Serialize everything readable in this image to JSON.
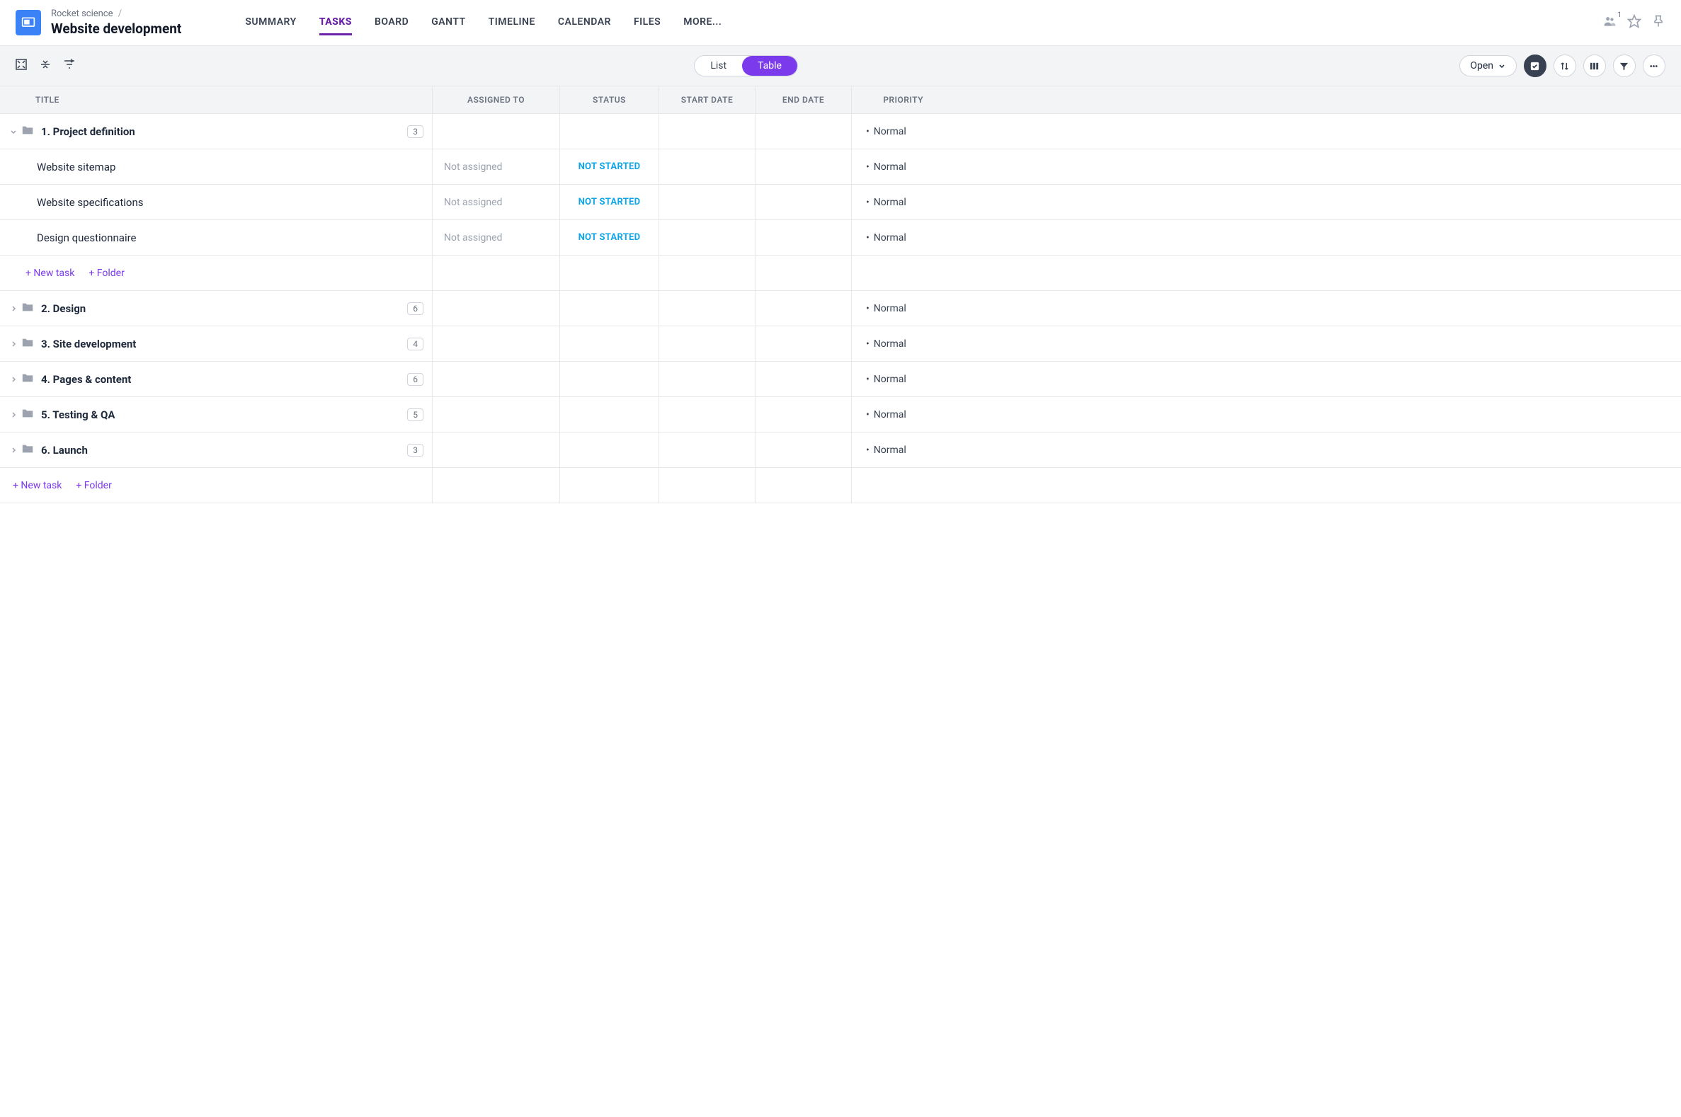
{
  "header": {
    "breadcrumb_parent": "Rocket science",
    "project_title": "Website development",
    "tabs": [
      "SUMMARY",
      "TASKS",
      "BOARD",
      "GANTT",
      "TIMELINE",
      "CALENDAR",
      "FILES",
      "MORE..."
    ],
    "active_tab": 1,
    "member_count": "1"
  },
  "toolbar": {
    "view_list": "List",
    "view_table": "Table",
    "open_label": "Open"
  },
  "columns": {
    "title": "TITLE",
    "assigned": "ASSIGNED TO",
    "status": "STATUS",
    "start": "START DATE",
    "end": "END DATE",
    "priority": "PRIORITY"
  },
  "groups": [
    {
      "title": "1. Project definition",
      "count": "3",
      "expanded": true,
      "priority": "Normal",
      "tasks": [
        {
          "title": "Website sitemap",
          "assigned": "Not assigned",
          "status": "NOT STARTED",
          "priority": "Normal"
        },
        {
          "title": "Website specifications",
          "assigned": "Not assigned",
          "status": "NOT STARTED",
          "priority": "Normal"
        },
        {
          "title": "Design questionnaire",
          "assigned": "Not assigned",
          "status": "NOT STARTED",
          "priority": "Normal"
        }
      ]
    },
    {
      "title": "2. Design",
      "count": "6",
      "expanded": false,
      "priority": "Normal"
    },
    {
      "title": "3. Site development",
      "count": "4",
      "expanded": false,
      "priority": "Normal"
    },
    {
      "title": "4. Pages & content",
      "count": "6",
      "expanded": false,
      "priority": "Normal"
    },
    {
      "title": "5. Testing & QA",
      "count": "5",
      "expanded": false,
      "priority": "Normal"
    },
    {
      "title": "6. Launch",
      "count": "3",
      "expanded": false,
      "priority": "Normal"
    }
  ],
  "actions": {
    "new_task": "+ New task",
    "folder": "+ Folder"
  }
}
